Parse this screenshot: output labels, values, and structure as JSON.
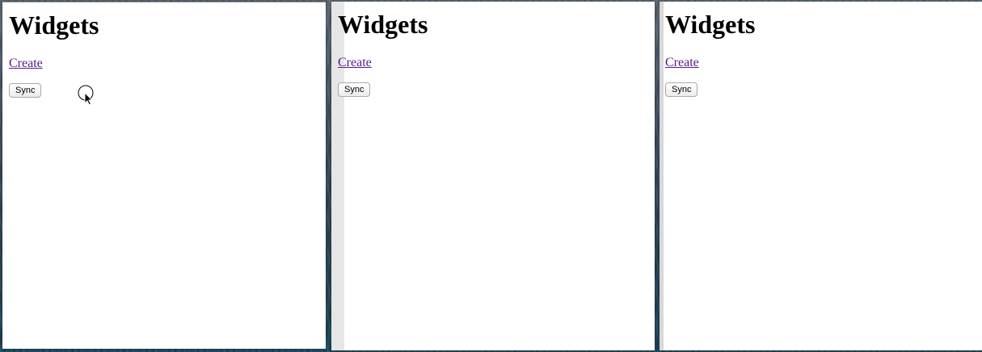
{
  "windows": [
    {
      "title": "Widgets",
      "create_label": "Create",
      "sync_label": "Sync"
    },
    {
      "title": "Widgets",
      "create_label": "Create",
      "sync_label": "Sync"
    },
    {
      "title": "Widgets",
      "create_label": "Create",
      "sync_label": "Sync"
    }
  ],
  "colors": {
    "link_visited": "#551a8b",
    "page_background": "#ffffff",
    "wallpaper": "#2b4556"
  },
  "icons": {
    "cursor": "pointer-cursor-with-click-ring-icon"
  }
}
